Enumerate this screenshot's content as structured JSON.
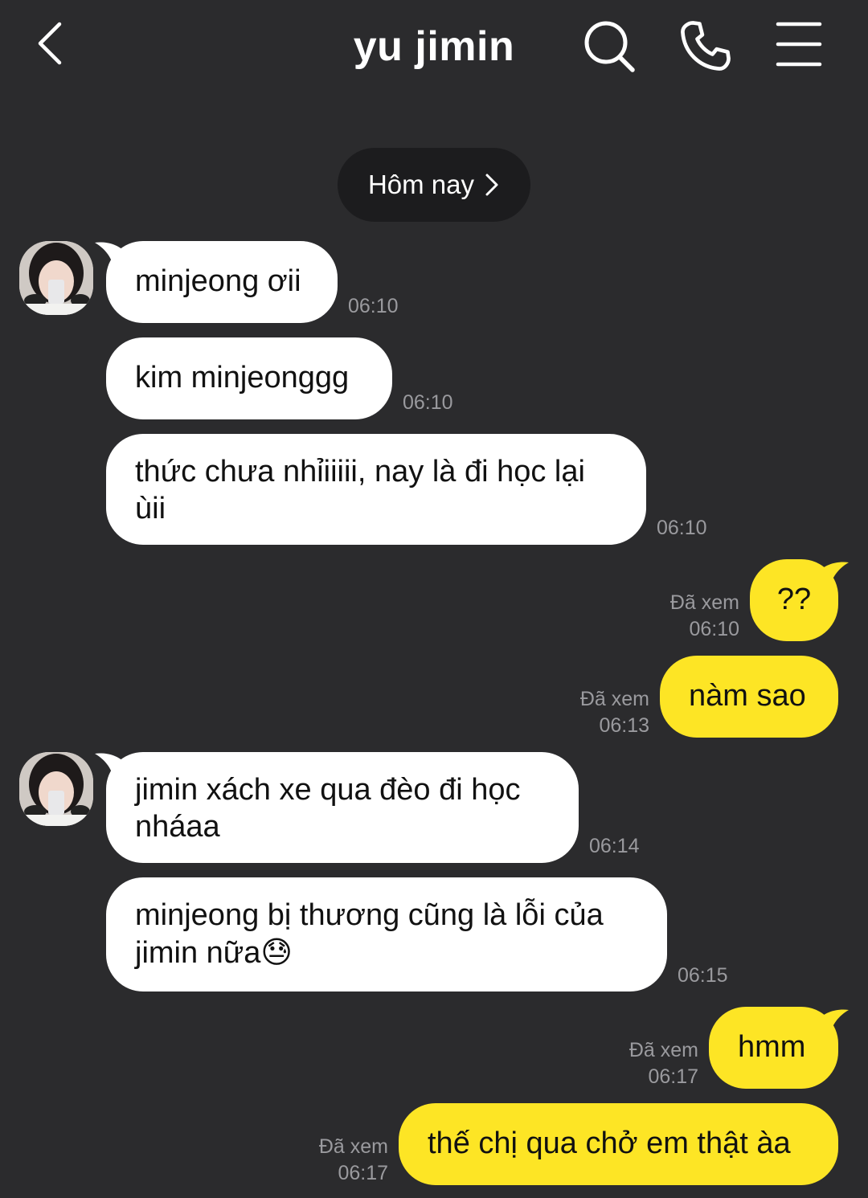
{
  "header": {
    "title": "yu jimin",
    "icons": [
      "back-icon",
      "search-icon",
      "phone-icon",
      "menu-icon"
    ]
  },
  "date_divider": {
    "label": "Hôm nay"
  },
  "messages": [
    {
      "side": "in",
      "text": "minjeong ơii",
      "time": "06:10"
    },
    {
      "side": "in",
      "text": "kim minjeonggg",
      "time": "06:10"
    },
    {
      "side": "in",
      "text": "thức chưa nhỉiiiii, nay là đi học lại ùii",
      "time": "06:10"
    },
    {
      "side": "out",
      "text": "??",
      "status": "Đã xem",
      "time": "06:10"
    },
    {
      "side": "out",
      "text": "nàm sao",
      "status": "Đã xem",
      "time": "06:13"
    },
    {
      "side": "in",
      "text": "jimin xách xe qua đèo đi học nháaa",
      "time": "06:14"
    },
    {
      "side": "in",
      "text": "minjeong bị thương cũng là lỗi của jimin nữa",
      "emoji": "😓",
      "time": "06:15"
    },
    {
      "side": "out",
      "text": "hmm",
      "status": "Đã xem",
      "time": "06:17"
    },
    {
      "side": "out",
      "text": "thế chị qua chở em thật àa",
      "status": "Đã xem",
      "time": "06:17"
    }
  ],
  "colors": {
    "background": "#2b2b2d",
    "incoming_bubble": "#ffffff",
    "outgoing_bubble": "#fde525",
    "timestamp": "#9a9a9e",
    "date_pill": "#1c1c1e"
  }
}
